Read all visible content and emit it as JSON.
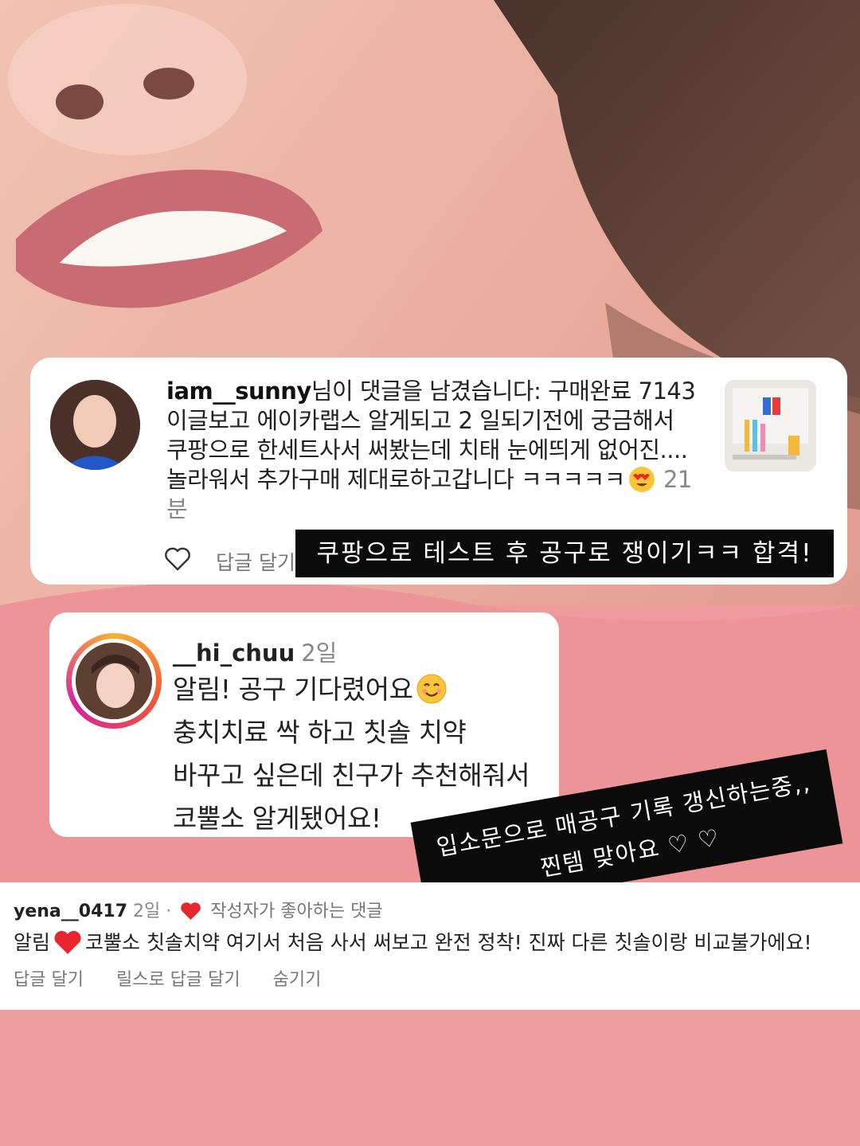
{
  "card1": {
    "username": "iam__sunny",
    "message": "님이 댓글을 남겼습니다: 구매완료 7143 이글보고 에이카랩스 알게되고 2 일되기전에 궁금해서 쿠팡으로 한세트사서 써봤는데 치태 눈에띄게 없어진.... 놀라워서 추가구매 제대로하고갑니다 ㅋㅋㅋㅋㅋ",
    "emoji": "heart-eyes-emoji",
    "timestamp": "21분",
    "reply_label": "답글 달기"
  },
  "banner1": {
    "text": "쿠팡으로 테스트 후 공구로 쟁이기ㅋㅋ 합격!"
  },
  "card2": {
    "username": "__hi_chuu",
    "timestamp": "2일",
    "lines": [
      "알림! 공구 기다렸어요",
      "충치치료 싹 하고 칫솔 치약",
      "바꾸고 싶은데 친구가 추천해줘서",
      "코뿔소 알게됐어요!"
    ],
    "emoji": "smiling-emoji"
  },
  "banner2": {
    "line1": "입소문으로 매공구 기록 갱신하는중,,",
    "line2": "찐템 맞아요 ♡ ♡"
  },
  "panel": {
    "username": "yena__0417",
    "timestamp": "2일",
    "separator": "·",
    "liked_by_author": "작성자가 좋아하는 댓글",
    "body_prefix": "알림",
    "body_rest": "코뿔소 칫솔치약 여기서 처음 사서 써보고 완전 정착! 진짜 다른 칫솔이랑 비교불가에요!",
    "actions": [
      "답글 달기",
      "릴스로 답글 달기",
      "숨기기"
    ]
  },
  "colors": {
    "heart_red": "#e8262d",
    "banner_bg": "#0b0b0b",
    "muted_text": "#777777"
  }
}
